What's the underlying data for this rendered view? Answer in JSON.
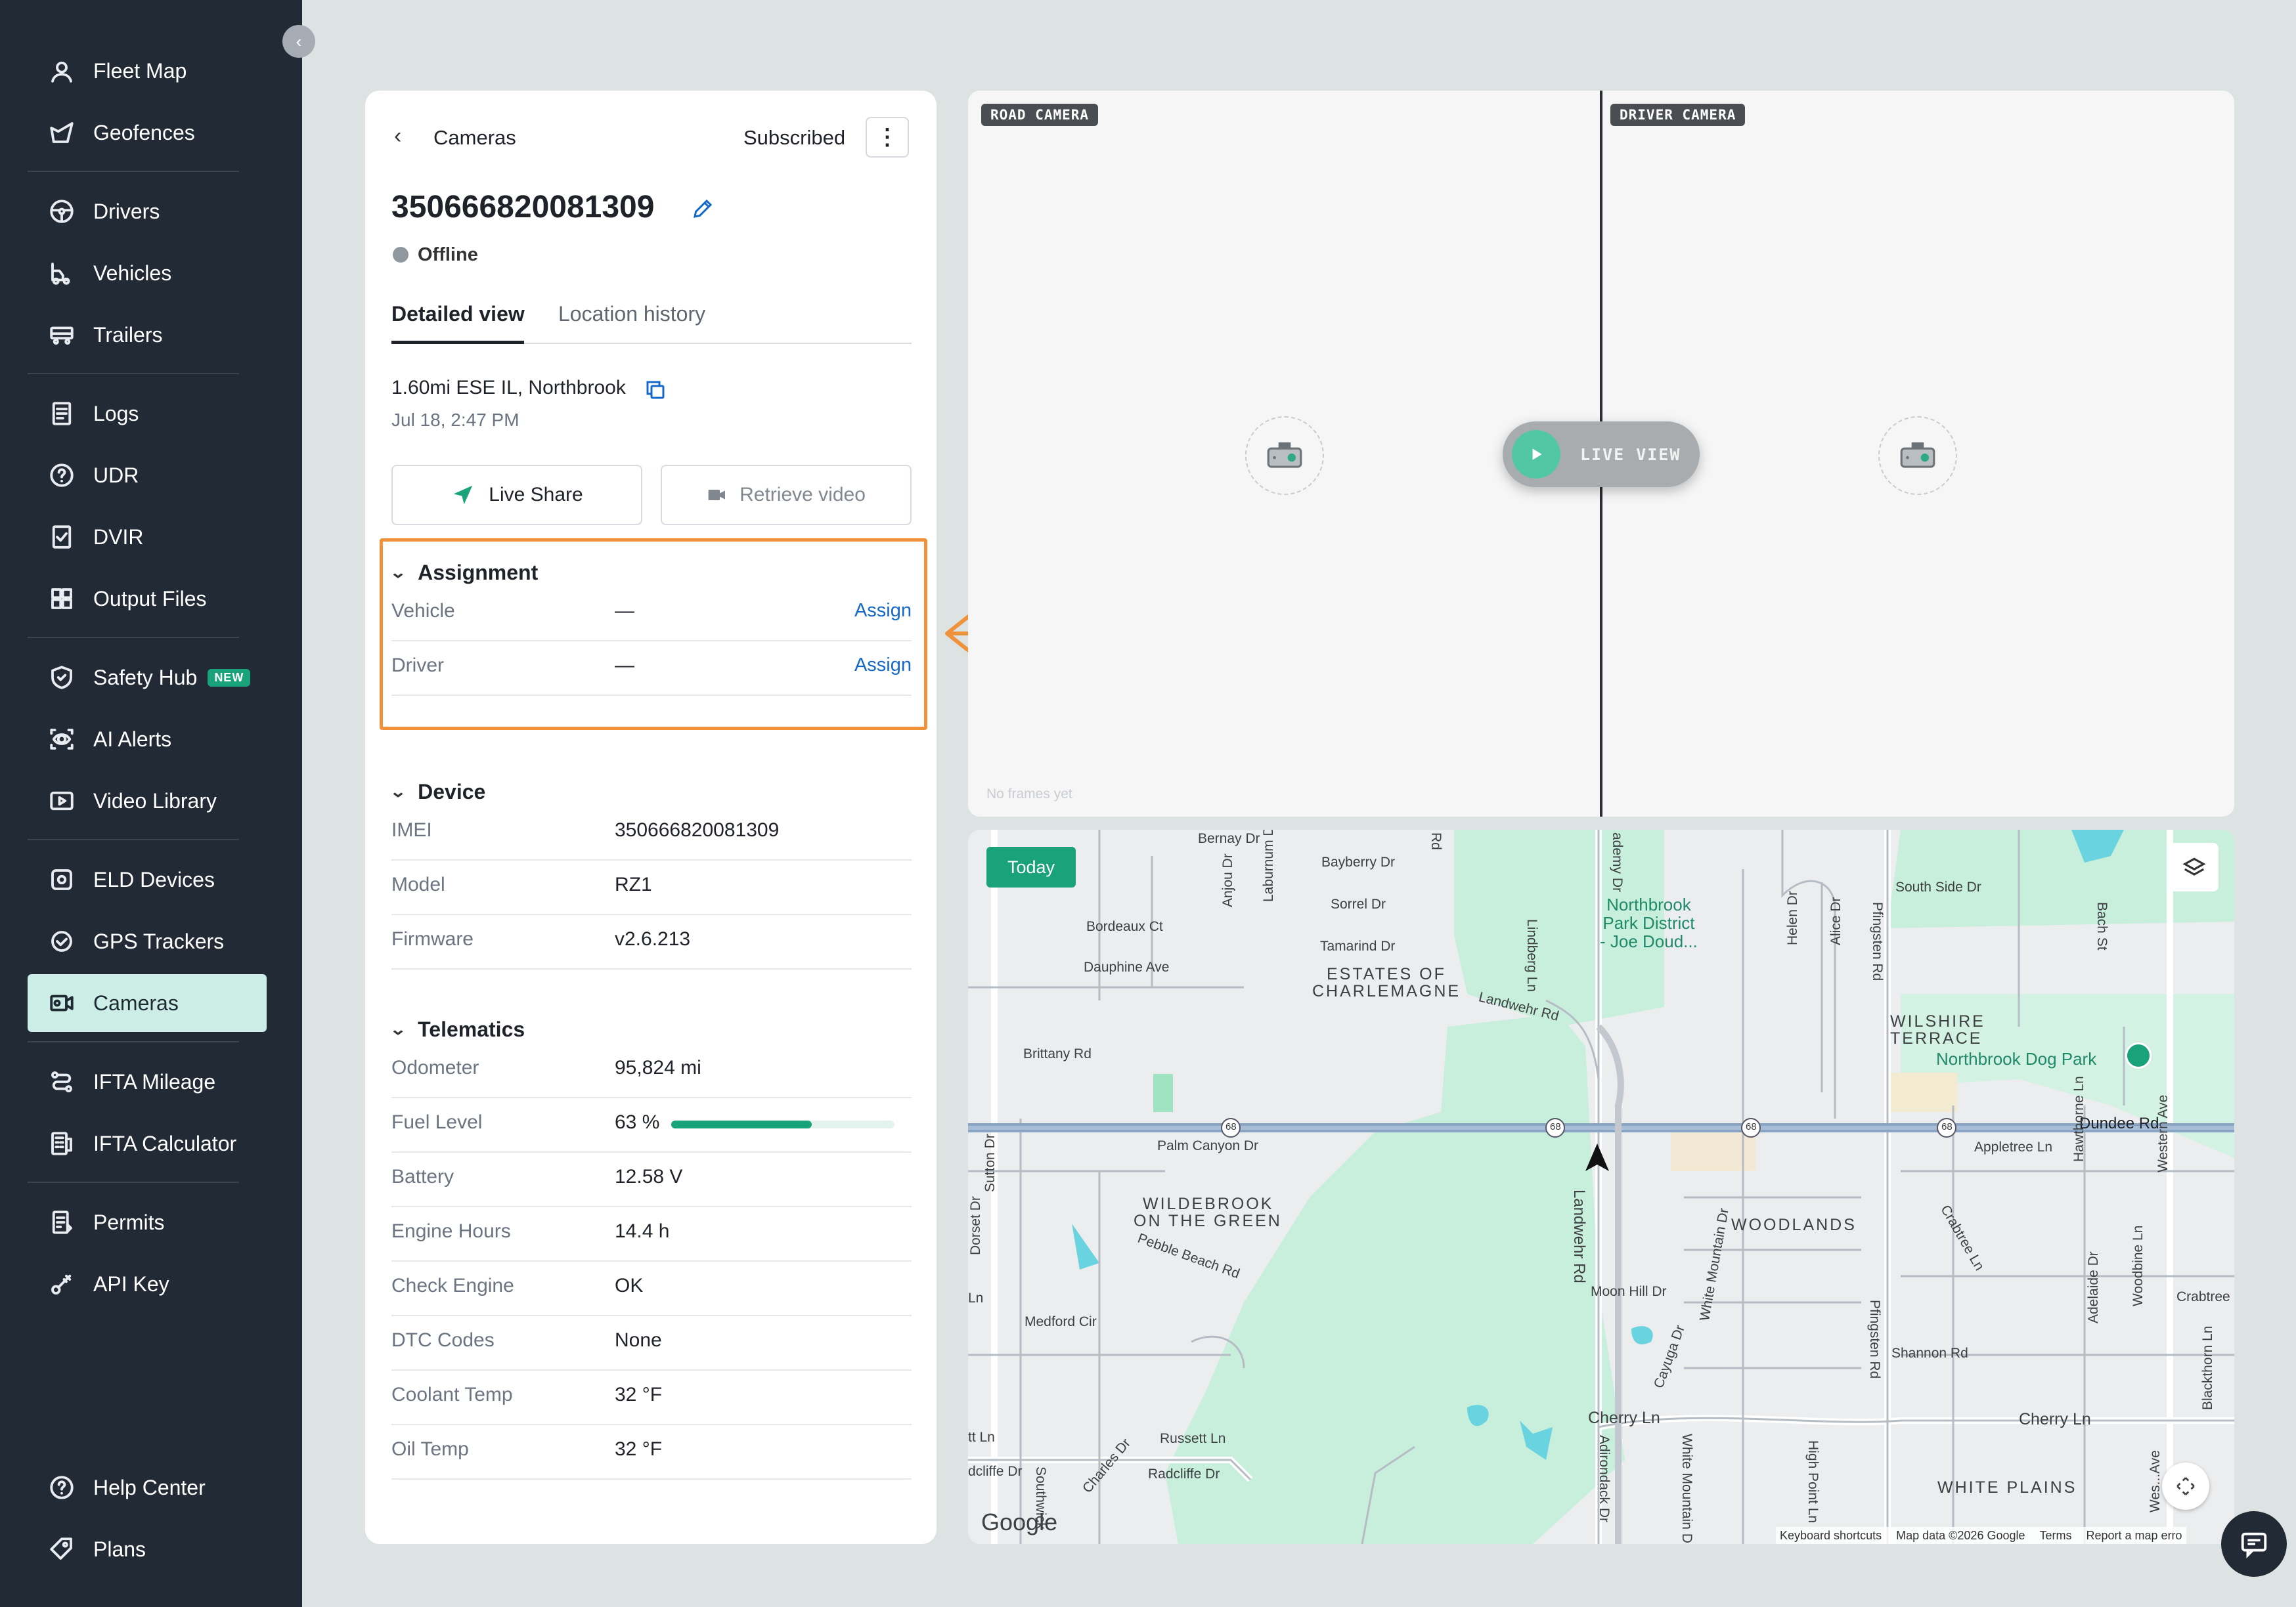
{
  "sidebar": {
    "items": [
      {
        "label": "Fleet Map",
        "icon": "map-pin-icon"
      },
      {
        "label": "Geofences",
        "icon": "geofence-icon"
      },
      {
        "label": "Drivers",
        "icon": "steering-wheel-icon"
      },
      {
        "label": "Vehicles",
        "icon": "truck-icon"
      },
      {
        "label": "Trailers",
        "icon": "trailer-icon"
      },
      {
        "label": "Logs",
        "icon": "clipboard-icon"
      },
      {
        "label": "UDR",
        "icon": "question-circle-icon"
      },
      {
        "label": "DVIR",
        "icon": "checklist-icon"
      },
      {
        "label": "Output Files",
        "icon": "grid-files-icon"
      },
      {
        "label": "Safety Hub",
        "icon": "shield-icon",
        "badge": "NEW"
      },
      {
        "label": "AI Alerts",
        "icon": "ai-eye-icon"
      },
      {
        "label": "Video Library",
        "icon": "play-square-icon"
      },
      {
        "label": "ELD Devices",
        "icon": "gear-device-icon"
      },
      {
        "label": "GPS Trackers",
        "icon": "gps-icon"
      },
      {
        "label": "Cameras",
        "icon": "camera-icon",
        "active": true
      },
      {
        "label": "IFTA Mileage",
        "icon": "route-icon"
      },
      {
        "label": "IFTA Calculator",
        "icon": "calculator-icon"
      },
      {
        "label": "Permits",
        "icon": "permit-icon"
      },
      {
        "label": "API Key",
        "icon": "key-icon"
      },
      {
        "label": "Help Center",
        "icon": "help-icon"
      },
      {
        "label": "Plans",
        "icon": "tag-icon"
      }
    ]
  },
  "panel": {
    "back_label": "Cameras",
    "subscription": "Subscribed",
    "device_id": "350666820081309",
    "status": "Offline",
    "tabs": [
      "Detailed view",
      "Location history"
    ],
    "location": "1.60mi ESE IL, Northbrook",
    "timestamp": "Jul 18, 2:47 PM",
    "live_share_label": "Live Share",
    "retrieve_video_label": "Retrieve video",
    "assignment": {
      "title": "Assignment",
      "rows": [
        {
          "key": "Vehicle",
          "value": "—",
          "action": "Assign"
        },
        {
          "key": "Driver",
          "value": "—",
          "action": "Assign"
        }
      ]
    },
    "device": {
      "title": "Device",
      "rows": [
        {
          "key": "IMEI",
          "value": "350666820081309"
        },
        {
          "key": "Model",
          "value": "RZ1"
        },
        {
          "key": "Firmware",
          "value": "v2.6.213"
        }
      ]
    },
    "telematics": {
      "title": "Telematics",
      "rows": [
        {
          "key": "Odometer",
          "value": "95,824 mi"
        },
        {
          "key": "Fuel Level",
          "value": "63 %",
          "progress": 0.63
        },
        {
          "key": "Battery",
          "value": "12.58 V"
        },
        {
          "key": "Engine Hours",
          "value": "14.4 h"
        },
        {
          "key": "Check Engine",
          "value": "OK"
        },
        {
          "key": "DTC Codes",
          "value": "None"
        },
        {
          "key": "Coolant Temp",
          "value": "32 °F"
        },
        {
          "key": "Oil Temp",
          "value": "32 °F"
        }
      ]
    }
  },
  "cameras": {
    "road_label": "ROAD CAMERA",
    "driver_label": "DRIVER CAMERA",
    "live_view_label": "LIVE VIEW",
    "no_frames": "No frames yet"
  },
  "map": {
    "today_label": "Today",
    "footer": {
      "keyboard": "Keyboard shortcuts",
      "mapdata": "Map data ©2026 Google",
      "terms": "Terms",
      "report": "Report a map erro"
    },
    "google": "Google",
    "labels": {
      "bernay": "Bernay Dr",
      "bayberry": "Bayberry Dr",
      "sorrel": "Sorrel Dr",
      "tamarind": "Tamarind Dr",
      "bordeaux": "Bordeaux Ct",
      "dauphine": "Dauphine Ave",
      "estates1": "ESTATES OF",
      "estates2": "CHARLEMAGNE",
      "landwehr_rd": "Landwehr Rd",
      "northbrook_park": "Northbrook\nPark District\n- Joe Doud...",
      "brittany": "Brittany Rd",
      "palm": "Palm Canyon Dr",
      "wildebrook1": "WILDEBROOK",
      "wildebrook2": "ON THE GREEN",
      "pebble": "Pebble Beach Rd",
      "medford": "Medford Cir",
      "woodlands": "WOODLANDS",
      "moonhill": "Moon Hill Dr",
      "south_side": "South Side Dr",
      "wilshire1": "WILSHIRE",
      "wilshire2": "TERRACE",
      "dogpark": "Northbrook Dog Park",
      "dundee": "Dundee Rd",
      "appletree": "Appletree Ln",
      "shannon": "Shannon Rd",
      "cherry1": "Cherry Ln",
      "cherry2": "Cherry Ln",
      "russett": "Russett Ln",
      "radcliffe": "Radcliffe Dr",
      "white_plains": "WHITE PLAINS",
      "pfingsten": "Pfingsten Rd",
      "landwehr_v": "Landwehr Rd",
      "crabtree": "Crabtree",
      "helen": "Helen Dr",
      "alice": "Alice Dr",
      "bach": "Bach St",
      "anjou": "Anjou Dr",
      "laburnum": "Laburnum Dr",
      "lindberg": "Lindberg Ln",
      "sutton": "Sutton Dr",
      "dorset": "Dorset Dr",
      "hawthorne": "Hawthorne Ln",
      "western": "Western Ave",
      "woodbine": "Woodbine Ln",
      "blackthorn": "Blackthorn Ln",
      "charles": "Charles Dr",
      "adirondack": "Adirondack Dr",
      "whitemtn": "White Mountain Dr",
      "highpoint": "High Point Ln",
      "cayuga": "Cayuga Dr",
      "route": "68",
      "adelaide": "Adelaide Dr",
      "rd": "Rd",
      "academy": "ademy Dr",
      "ln_left": "Ln",
      "tt_ln": "tt Ln",
      "dcliffe": "dcliffe Dr",
      "southwick": "Southwick",
      "crabtree_ln": "Crabtree Ln",
      "westn_short": "Wes...Ave"
    }
  }
}
